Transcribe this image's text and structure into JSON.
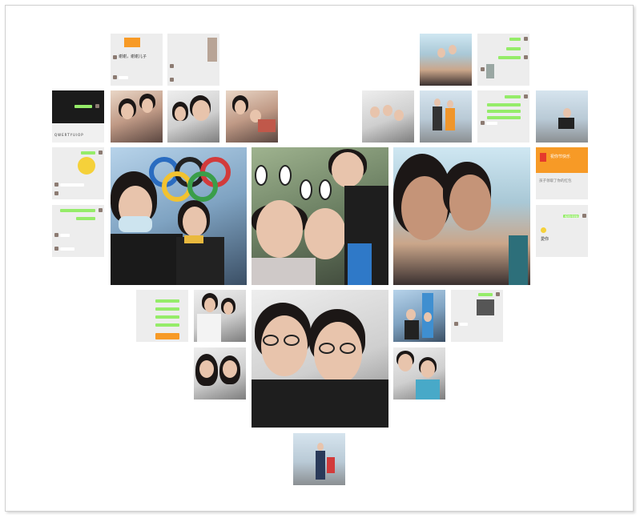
{
  "collage": {
    "type": "heart-shaped photo collage",
    "captions": {
      "red_packet_title": "祝你节快乐",
      "red_packet_note": "孩子领取了你的红包",
      "son_label": "儿子",
      "red_packet_title2": "祝你节快乐",
      "chat_words": "愛你",
      "screenshot_reply": "谢谢，谢谢儿子",
      "kbd_row": "QWERTYUIOP"
    },
    "colors": {
      "chat_green": "#95ec69",
      "wechat_orange": "#f79a26",
      "frame_border": "#cfcfcf"
    }
  }
}
